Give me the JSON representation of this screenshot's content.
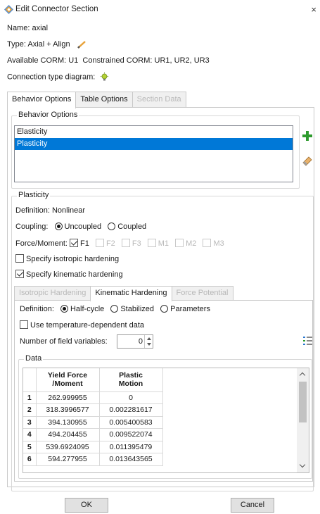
{
  "window": {
    "title": "Edit Connector Section",
    "close_label": "×"
  },
  "info": {
    "name_label": "Name:",
    "name_value": "axial",
    "type_label": "Type:",
    "type_value": "Axial + Align",
    "corm_label": "Available CORM:",
    "corm_value": "U1",
    "constrained_label": "Constrained CORM:",
    "constrained_value": "UR1, UR2, UR3",
    "diagram_label": "Connection type diagram:"
  },
  "tabs": [
    "Behavior Options",
    "Table Options",
    "Section Data"
  ],
  "behavior": {
    "group_title": "Behavior Options",
    "items": [
      "Elasticity",
      "Plasticity"
    ],
    "selected": "Plasticity",
    "add_icon": "green-plus-icon",
    "edit_icon": "eraser-icon"
  },
  "plasticity": {
    "group_title": "Plasticity",
    "definition_label": "Definition:",
    "definition_value": "Nonlinear",
    "coupling_label": "Coupling:",
    "coupling_options": [
      "Uncoupled",
      "Coupled"
    ],
    "coupling_selected": "Uncoupled",
    "force_label": "Force/Moment:",
    "dofs": [
      "F1",
      "F2",
      "F3",
      "M1",
      "M2",
      "M3"
    ],
    "iso_label": "Specify isotropic hardening",
    "iso_checked": false,
    "kin_label": "Specify kinematic hardening",
    "kin_checked": true
  },
  "subtabs": [
    "Isotropic Hardening",
    "Kinematic Hardening",
    "Force Potential"
  ],
  "kinematic": {
    "definition_label": "Definition:",
    "definition_options": [
      "Half-cycle",
      "Stabilized",
      "Parameters"
    ],
    "definition_selected": "Half-cycle",
    "temp_label": "Use temperature-dependent data",
    "field_label": "Number of field variables:",
    "field_value": "0"
  },
  "data_table": {
    "title": "Data",
    "columns": [
      "Yield Force /Moment",
      "Plastic Motion"
    ],
    "col1_line1": "Yield Force",
    "col1_line2": "/Moment",
    "col2_line1": "Plastic",
    "col2_line2": "Motion",
    "rows": [
      [
        "1",
        "262.999955",
        "0"
      ],
      [
        "2",
        "318.3996577",
        "0.002281617"
      ],
      [
        "3",
        "394.130955",
        "0.005400583"
      ],
      [
        "4",
        "494.204455",
        "0.009522074"
      ],
      [
        "5",
        "539.6924095",
        "0.011395479"
      ],
      [
        "6",
        "594.277955",
        "0.013643565"
      ]
    ]
  },
  "buttons": {
    "ok": "OK",
    "cancel": "Cancel"
  },
  "colors": {
    "selection": "#0078d7",
    "add_green": "#2e9b2e"
  }
}
